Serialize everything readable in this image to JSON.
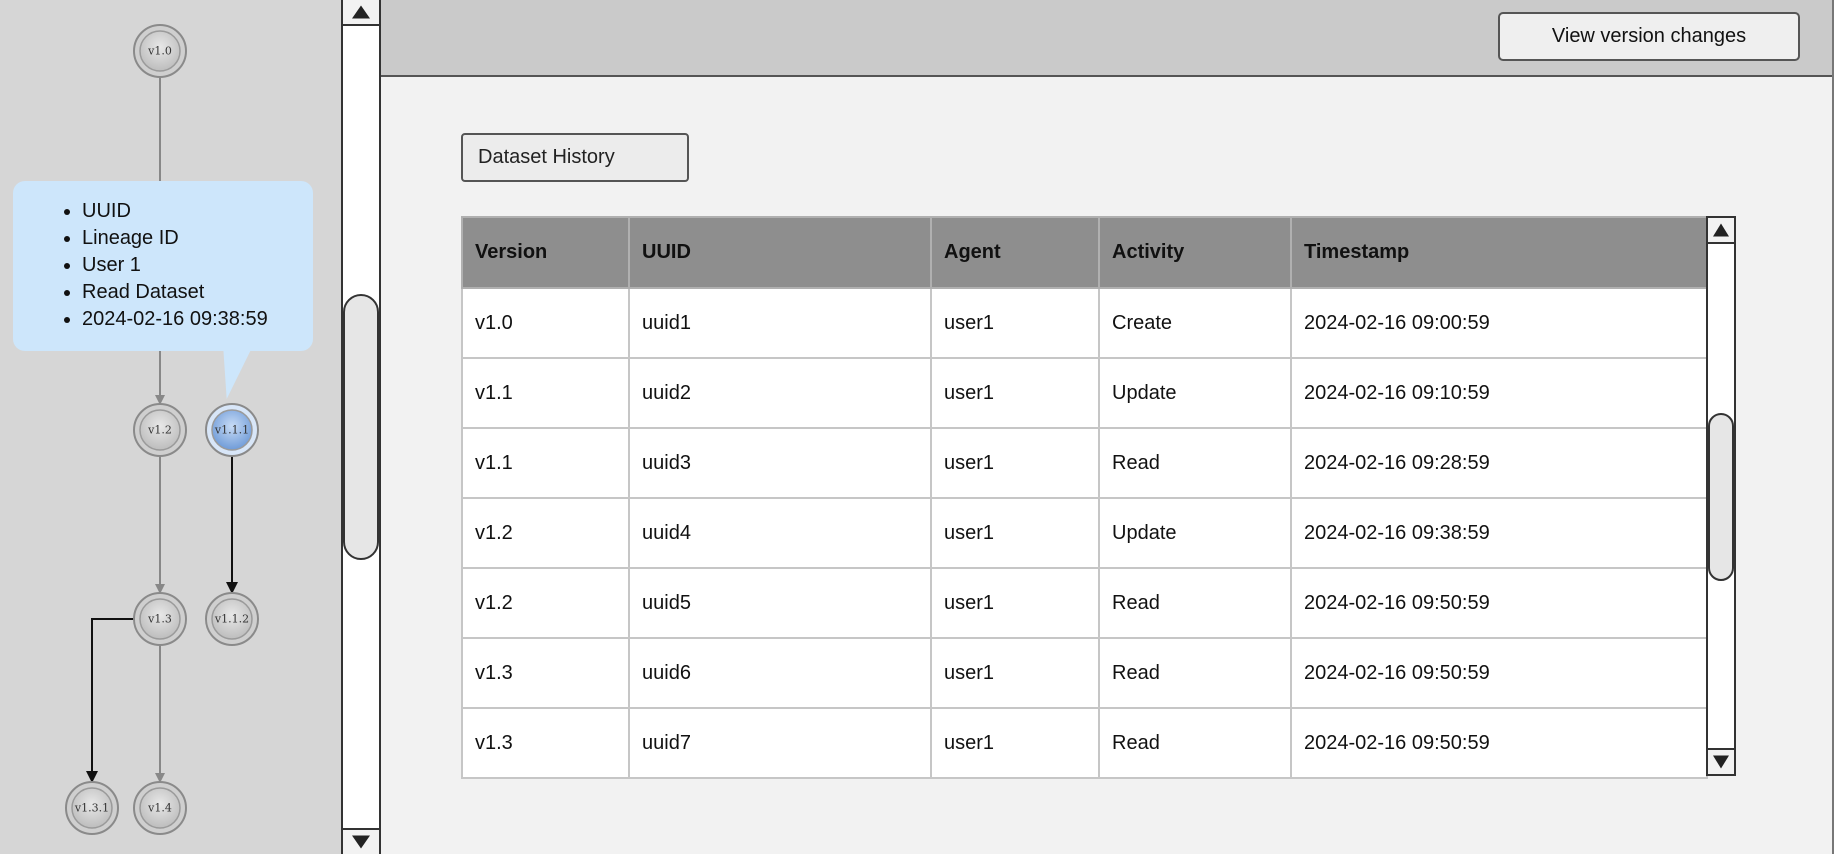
{
  "graph": {
    "nodes": [
      {
        "id": "v1.0",
        "label": "v1.0",
        "selected": false
      },
      {
        "id": "v1.2",
        "label": "v1.2",
        "selected": false
      },
      {
        "id": "v1.1.1",
        "label": "v1.1.1",
        "selected": true
      },
      {
        "id": "v1.3",
        "label": "v1.3",
        "selected": false
      },
      {
        "id": "v1.1.2",
        "label": "v1.1.2",
        "selected": false
      },
      {
        "id": "v1.3.1",
        "label": "v1.3.1",
        "selected": false
      },
      {
        "id": "v1.4",
        "label": "v1.4",
        "selected": false
      }
    ],
    "edges": [
      {
        "from": "v1.0",
        "to": "v1.2"
      },
      {
        "from": "v1.2",
        "to": "v1.3"
      },
      {
        "from": "v1.1.1",
        "to": "v1.1.2"
      },
      {
        "from": "v1.3",
        "to": "v1.3.1"
      },
      {
        "from": "v1.3",
        "to": "v1.4"
      }
    ],
    "tooltip": {
      "items": [
        "UUID",
        "Lineage ID",
        "User 1",
        "Read Dataset",
        "2024-02-16 09:38:59"
      ]
    }
  },
  "toolbar": {
    "view_changes_label": "View version changes"
  },
  "main": {
    "section_label": "Dataset History",
    "table": {
      "columns": [
        "Version",
        "UUID",
        "Agent",
        "Activity",
        "Timestamp"
      ],
      "rows": [
        [
          "v1.0",
          "uuid1",
          "user1",
          "Create",
          "2024-02-16 09:00:59"
        ],
        [
          "v1.1",
          "uuid2",
          "user1",
          "Update",
          "2024-02-16 09:10:59"
        ],
        [
          "v1.1",
          "uuid3",
          "user1",
          "Read",
          "2024-02-16 09:28:59"
        ],
        [
          "v1.2",
          "uuid4",
          "user1",
          "Update",
          "2024-02-16 09:38:59"
        ],
        [
          "v1.2",
          "uuid5",
          "user1",
          "Read",
          "2024-02-16 09:50:59"
        ],
        [
          "v1.3",
          "uuid6",
          "user1",
          "Read",
          "2024-02-16 09:50:59"
        ],
        [
          "v1.3",
          "uuid7",
          "user1",
          "Read",
          "2024-02-16 09:50:59"
        ]
      ]
    }
  },
  "colors": {
    "node_selected": "#8fb4e6",
    "tooltip_bg": "#cde6fb",
    "header_bg": "#8e8e8e"
  }
}
